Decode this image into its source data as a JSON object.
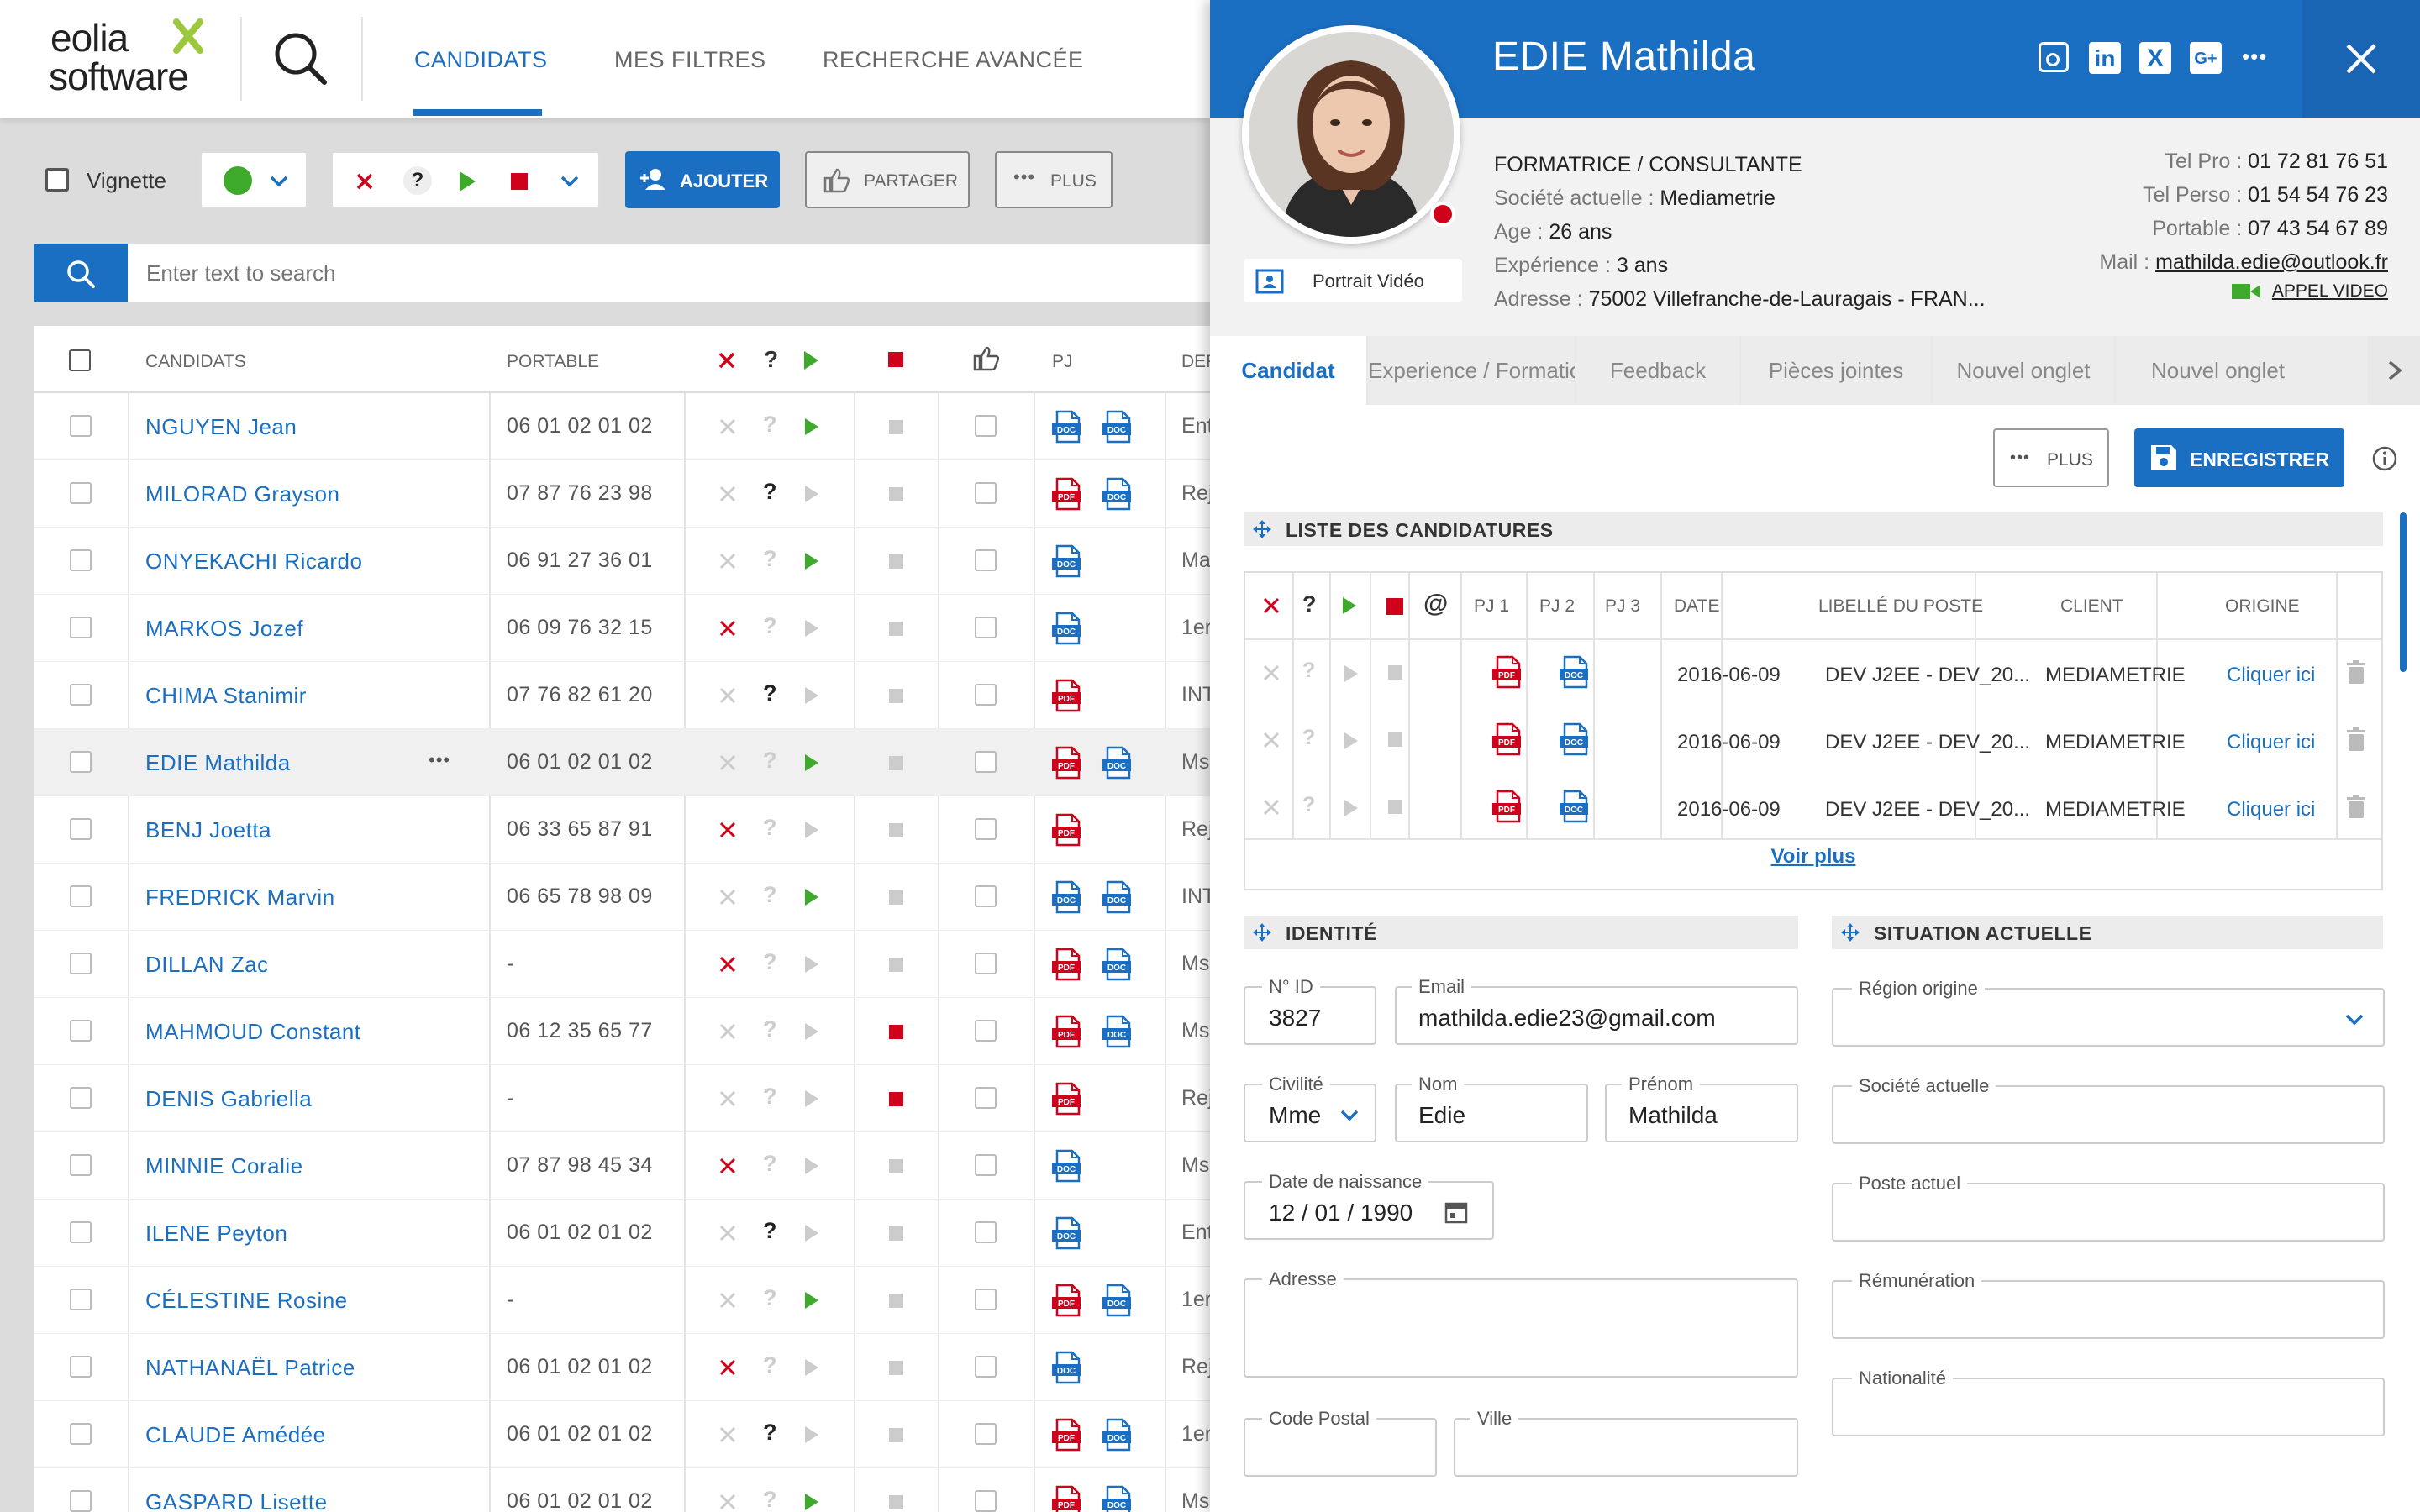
{
  "brand": {
    "line1": "eolia",
    "line2": "software"
  },
  "nav": {
    "tabs": [
      {
        "label": "CANDIDATS"
      },
      {
        "label": "MES FILTRES"
      },
      {
        "label": "RECHERCHE AVANCÉE"
      }
    ]
  },
  "toolbar": {
    "vignette_label": "Vignette",
    "add_label": "AJOUTER",
    "share_label": "PARTAGER",
    "more_label": "PLUS"
  },
  "search": {
    "placeholder": "Enter text to search"
  },
  "colors": {
    "accent": "#1b6fc2",
    "red": "#d0021b",
    "green": "#3daa2b",
    "pdf": "#d0021b",
    "doc": "#1b6fc2"
  },
  "table": {
    "headers": {
      "candidats": "CANDIDATS",
      "portable": "PORTABLE",
      "pj": "PJ",
      "def": "DEF"
    },
    "rows": [
      {
        "name": "NGUYEN Jean",
        "phone": "06 01 02 01 02",
        "status": "go",
        "thumb": false,
        "files": [
          "doc",
          "doc"
        ],
        "def": "Ent"
      },
      {
        "name": "MILORAD Grayson",
        "phone": "07 87 76 23 98",
        "status": "q",
        "thumb": false,
        "files": [
          "pdf",
          "doc"
        ],
        "def": "Rej"
      },
      {
        "name": "ONYEKACHI Ricardo",
        "phone": "06 91 27 36 01",
        "status": "go",
        "thumb": false,
        "files": [
          "doc"
        ],
        "def": "Ma"
      },
      {
        "name": "MARKOS Jozef",
        "phone": "06 09 76 32 15",
        "status": "x",
        "thumb": false,
        "files": [
          "doc"
        ],
        "def": "1er"
      },
      {
        "name": "CHIMA Stanimir",
        "phone": "07 76 82 61 20",
        "status": "q",
        "thumb": false,
        "files": [
          "pdf"
        ],
        "def": "INT"
      },
      {
        "name": "EDIE Mathilda",
        "phone": "06 01 02 01 02",
        "status": "go",
        "thumb": false,
        "files": [
          "pdf",
          "doc"
        ],
        "def": "Ms"
      },
      {
        "name": "BENJ Joetta",
        "phone": "06 33 65 87 91",
        "status": "x",
        "thumb": false,
        "files": [
          "pdf"
        ],
        "def": "Rej"
      },
      {
        "name": "FREDRICK Marvin",
        "phone": "06 65 78 98 09",
        "status": "go",
        "thumb": false,
        "files": [
          "doc",
          "doc"
        ],
        "def": "INT"
      },
      {
        "name": "DILLAN Zac",
        "phone": "-",
        "status": "x",
        "thumb": false,
        "files": [
          "pdf",
          "doc"
        ],
        "def": "Ms"
      },
      {
        "name": "MAHMOUD Constant",
        "phone": "06 12 35 65 77",
        "status": "stop",
        "thumb": false,
        "files": [
          "pdf",
          "doc"
        ],
        "def": "Ms"
      },
      {
        "name": "DENIS Gabriella",
        "phone": "-",
        "status": "stop",
        "thumb": false,
        "files": [
          "pdf"
        ],
        "def": "Rej"
      },
      {
        "name": "MINNIE Coralie",
        "phone": "07 87 98 45 34",
        "status": "x",
        "thumb": false,
        "files": [
          "doc"
        ],
        "def": "Ms"
      },
      {
        "name": "ILENE Peyton",
        "phone": "06 01 02 01 02",
        "status": "q",
        "thumb": false,
        "files": [
          "doc"
        ],
        "def": "Ent"
      },
      {
        "name": "CÉLESTINE Rosine",
        "phone": "-",
        "status": "go",
        "thumb": false,
        "files": [
          "pdf",
          "doc"
        ],
        "def": "1er"
      },
      {
        "name": "NATHANAËL Patrice",
        "phone": "06 01 02 01 02",
        "status": "x",
        "thumb": false,
        "files": [
          "doc"
        ],
        "def": "Rej"
      },
      {
        "name": "CLAUDE Amédée",
        "phone": "06 01 02 01 02",
        "status": "q",
        "thumb": false,
        "files": [
          "pdf",
          "doc"
        ],
        "def": "1er"
      },
      {
        "name": "GASPARD Lisette",
        "phone": "06 01 02 01 02",
        "status": "go",
        "thumb": false,
        "files": [
          "pdf",
          "doc"
        ],
        "def": "Ms"
      }
    ]
  },
  "profile": {
    "name": "EDIE Mathilda",
    "video_label": "Portrait Vidéo",
    "title": "FORMATRICE / CONSULTANTE",
    "company_label": "Société actuelle :",
    "company": "Mediametrie",
    "age_label": "Age :",
    "age": "26 ans",
    "exp_label": "Expérience :",
    "exp": "3 ans",
    "addr_label": "Adresse :",
    "addr": "75002 Villefranche-de-Lauragais - FRAN...",
    "tel_pro_label": "Tel Pro :",
    "tel_pro": "01 72 81 76 51",
    "tel_perso_label": "Tel Perso :",
    "tel_perso": "01 54 54 76 23",
    "portable_label": "Portable :",
    "portable": "07 43 54 67 89",
    "mail_label": "Mail :",
    "mail": "mathilda.edie@outlook.fr",
    "video_call": "APPEL VIDEO"
  },
  "panel_tabs": [
    "Candidat",
    "Experience / Formation",
    "Feedback",
    "Pièces jointes",
    "Nouvel onglet",
    "Nouvel onglet"
  ],
  "actions": {
    "more": "PLUS",
    "save": "ENREGISTRER"
  },
  "applications": {
    "title": "LISTE DES CANDIDATURES",
    "headers": {
      "pj1": "PJ 1",
      "pj2": "PJ 2",
      "pj3": "PJ 3",
      "date": "DATE",
      "job": "LIBELLÉ DU POSTE",
      "client": "CLIENT",
      "origin": "ORIGINE"
    },
    "rows": [
      {
        "date": "2016-06-09",
        "job": "DEV J2EE - DEV_20...",
        "client": "MEDIAMETRIE",
        "origin": "Cliquer ici"
      },
      {
        "date": "2016-06-09",
        "job": "DEV J2EE - DEV_20...",
        "client": "MEDIAMETRIE",
        "origin": "Cliquer ici"
      },
      {
        "date": "2016-06-09",
        "job": "DEV J2EE - DEV_20...",
        "client": "MEDIAMETRIE",
        "origin": "Cliquer ici"
      }
    ],
    "more": "Voir plus"
  },
  "identity": {
    "title": "IDENTITÉ",
    "id_label": "N° ID",
    "id": "3827",
    "email_label": "Email",
    "email": "mathilda.edie23@gmail.com",
    "civ_label": "Civilité",
    "civ": "Mme",
    "nom_label": "Nom",
    "nom": "Edie",
    "prenom_label": "Prénom",
    "prenom": "Mathilda",
    "dob_label": "Date de naissance",
    "dob": "12 / 01 / 1990",
    "addr_label": "Adresse",
    "cp_label": "Code Postal",
    "ville_label": "Ville"
  },
  "situation": {
    "title": "SITUATION ACTUELLE",
    "region_label": "Région origine",
    "company_label": "Société actuelle",
    "post_label": "Poste actuel",
    "pay_label": "Rémunération",
    "nat_label": "Nationalité"
  }
}
